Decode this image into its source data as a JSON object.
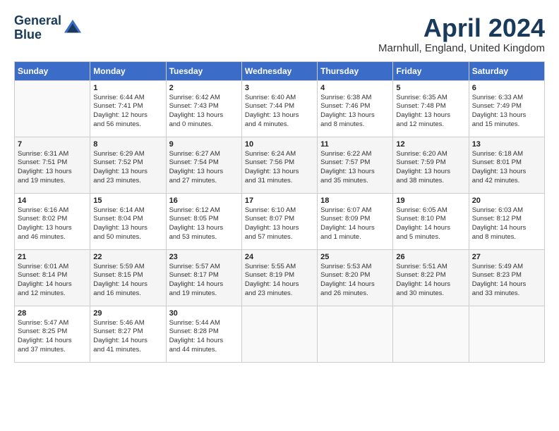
{
  "logo": {
    "line1": "General",
    "line2": "Blue"
  },
  "title": "April 2024",
  "location": "Marnhull, England, United Kingdom",
  "days_of_week": [
    "Sunday",
    "Monday",
    "Tuesday",
    "Wednesday",
    "Thursday",
    "Friday",
    "Saturday"
  ],
  "weeks": [
    [
      {
        "day": "",
        "info": ""
      },
      {
        "day": "1",
        "info": "Sunrise: 6:44 AM\nSunset: 7:41 PM\nDaylight: 12 hours\nand 56 minutes."
      },
      {
        "day": "2",
        "info": "Sunrise: 6:42 AM\nSunset: 7:43 PM\nDaylight: 13 hours\nand 0 minutes."
      },
      {
        "day": "3",
        "info": "Sunrise: 6:40 AM\nSunset: 7:44 PM\nDaylight: 13 hours\nand 4 minutes."
      },
      {
        "day": "4",
        "info": "Sunrise: 6:38 AM\nSunset: 7:46 PM\nDaylight: 13 hours\nand 8 minutes."
      },
      {
        "day": "5",
        "info": "Sunrise: 6:35 AM\nSunset: 7:48 PM\nDaylight: 13 hours\nand 12 minutes."
      },
      {
        "day": "6",
        "info": "Sunrise: 6:33 AM\nSunset: 7:49 PM\nDaylight: 13 hours\nand 15 minutes."
      }
    ],
    [
      {
        "day": "7",
        "info": "Sunrise: 6:31 AM\nSunset: 7:51 PM\nDaylight: 13 hours\nand 19 minutes."
      },
      {
        "day": "8",
        "info": "Sunrise: 6:29 AM\nSunset: 7:52 PM\nDaylight: 13 hours\nand 23 minutes."
      },
      {
        "day": "9",
        "info": "Sunrise: 6:27 AM\nSunset: 7:54 PM\nDaylight: 13 hours\nand 27 minutes."
      },
      {
        "day": "10",
        "info": "Sunrise: 6:24 AM\nSunset: 7:56 PM\nDaylight: 13 hours\nand 31 minutes."
      },
      {
        "day": "11",
        "info": "Sunrise: 6:22 AM\nSunset: 7:57 PM\nDaylight: 13 hours\nand 35 minutes."
      },
      {
        "day": "12",
        "info": "Sunrise: 6:20 AM\nSunset: 7:59 PM\nDaylight: 13 hours\nand 38 minutes."
      },
      {
        "day": "13",
        "info": "Sunrise: 6:18 AM\nSunset: 8:01 PM\nDaylight: 13 hours\nand 42 minutes."
      }
    ],
    [
      {
        "day": "14",
        "info": "Sunrise: 6:16 AM\nSunset: 8:02 PM\nDaylight: 13 hours\nand 46 minutes."
      },
      {
        "day": "15",
        "info": "Sunrise: 6:14 AM\nSunset: 8:04 PM\nDaylight: 13 hours\nand 50 minutes."
      },
      {
        "day": "16",
        "info": "Sunrise: 6:12 AM\nSunset: 8:05 PM\nDaylight: 13 hours\nand 53 minutes."
      },
      {
        "day": "17",
        "info": "Sunrise: 6:10 AM\nSunset: 8:07 PM\nDaylight: 13 hours\nand 57 minutes."
      },
      {
        "day": "18",
        "info": "Sunrise: 6:07 AM\nSunset: 8:09 PM\nDaylight: 14 hours\nand 1 minute."
      },
      {
        "day": "19",
        "info": "Sunrise: 6:05 AM\nSunset: 8:10 PM\nDaylight: 14 hours\nand 5 minutes."
      },
      {
        "day": "20",
        "info": "Sunrise: 6:03 AM\nSunset: 8:12 PM\nDaylight: 14 hours\nand 8 minutes."
      }
    ],
    [
      {
        "day": "21",
        "info": "Sunrise: 6:01 AM\nSunset: 8:14 PM\nDaylight: 14 hours\nand 12 minutes."
      },
      {
        "day": "22",
        "info": "Sunrise: 5:59 AM\nSunset: 8:15 PM\nDaylight: 14 hours\nand 16 minutes."
      },
      {
        "day": "23",
        "info": "Sunrise: 5:57 AM\nSunset: 8:17 PM\nDaylight: 14 hours\nand 19 minutes."
      },
      {
        "day": "24",
        "info": "Sunrise: 5:55 AM\nSunset: 8:19 PM\nDaylight: 14 hours\nand 23 minutes."
      },
      {
        "day": "25",
        "info": "Sunrise: 5:53 AM\nSunset: 8:20 PM\nDaylight: 14 hours\nand 26 minutes."
      },
      {
        "day": "26",
        "info": "Sunrise: 5:51 AM\nSunset: 8:22 PM\nDaylight: 14 hours\nand 30 minutes."
      },
      {
        "day": "27",
        "info": "Sunrise: 5:49 AM\nSunset: 8:23 PM\nDaylight: 14 hours\nand 33 minutes."
      }
    ],
    [
      {
        "day": "28",
        "info": "Sunrise: 5:47 AM\nSunset: 8:25 PM\nDaylight: 14 hours\nand 37 minutes."
      },
      {
        "day": "29",
        "info": "Sunrise: 5:46 AM\nSunset: 8:27 PM\nDaylight: 14 hours\nand 41 minutes."
      },
      {
        "day": "30",
        "info": "Sunrise: 5:44 AM\nSunset: 8:28 PM\nDaylight: 14 hours\nand 44 minutes."
      },
      {
        "day": "",
        "info": ""
      },
      {
        "day": "",
        "info": ""
      },
      {
        "day": "",
        "info": ""
      },
      {
        "day": "",
        "info": ""
      }
    ]
  ]
}
